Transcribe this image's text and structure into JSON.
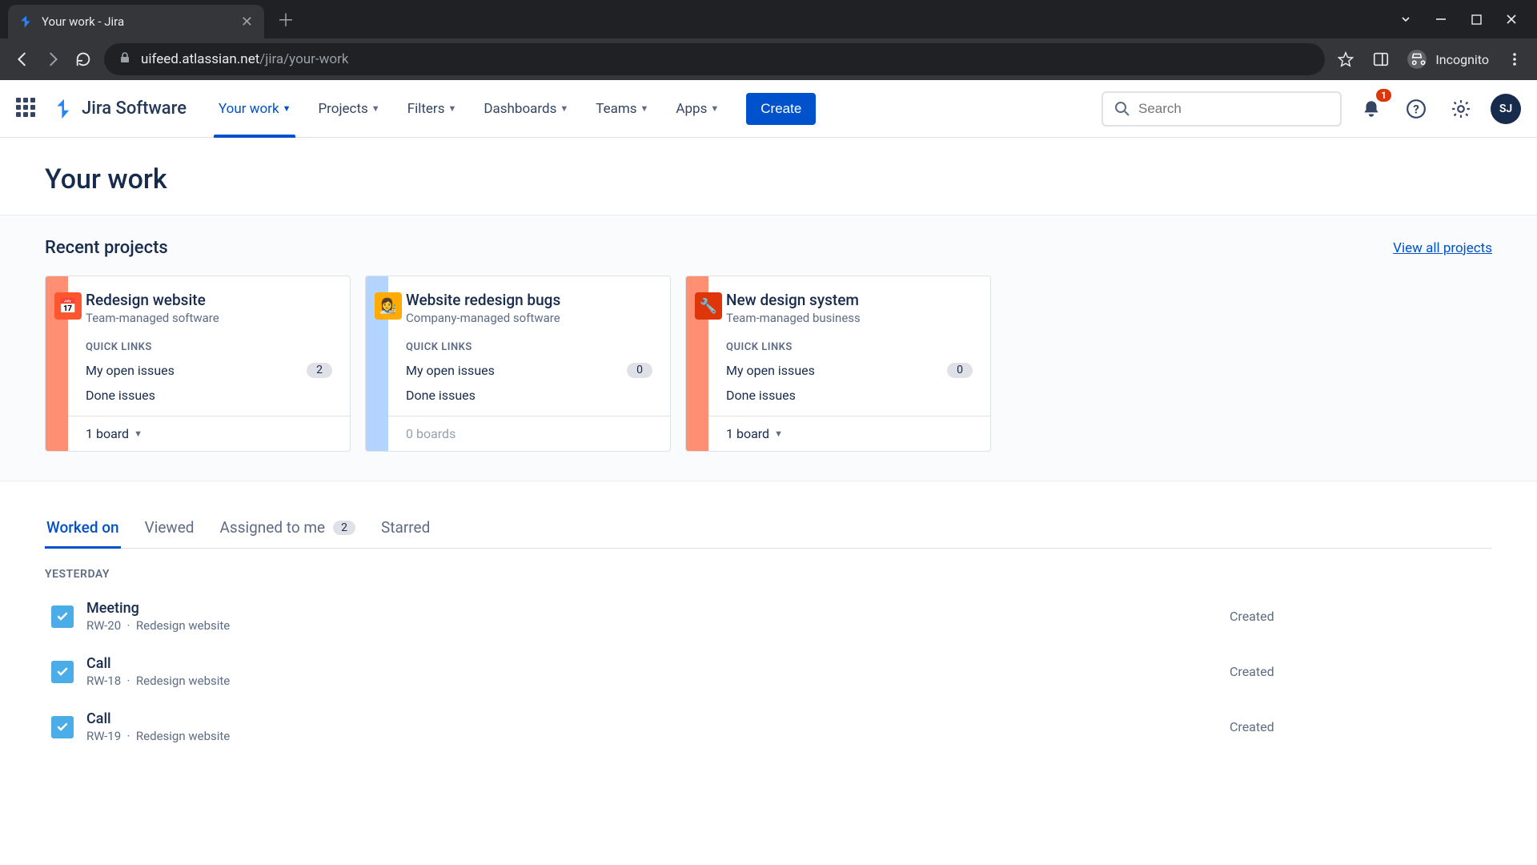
{
  "browser": {
    "tab_title": "Your work - Jira",
    "url_host": "uifeed.atlassian.net",
    "url_path": "/jira/your-work",
    "incognito_label": "Incognito"
  },
  "header": {
    "product_name": "Jira Software",
    "nav": {
      "your_work": "Your work",
      "projects": "Projects",
      "filters": "Filters",
      "dashboards": "Dashboards",
      "teams": "Teams",
      "apps": "Apps"
    },
    "create_label": "Create",
    "search_placeholder": "Search",
    "notification_count": "1",
    "avatar_initials": "SJ"
  },
  "page": {
    "title": "Your work",
    "recent_title": "Recent projects",
    "view_all_label": "View all projects"
  },
  "projects": [
    {
      "name": "Redesign website",
      "type": "Team-managed software",
      "stripe": "#ff8f73",
      "icon_bg": "#ff5630",
      "icon_glyph": "📅",
      "quick_label": "QUICK LINKS",
      "open_label": "My open issues",
      "open_count": "2",
      "done_label": "Done issues",
      "boards_label": "1 board",
      "has_boards": true
    },
    {
      "name": "Website redesign bugs",
      "type": "Company-managed software",
      "stripe": "#b3d4ff",
      "icon_bg": "#ffab00",
      "icon_glyph": "👩‍🎨",
      "quick_label": "QUICK LINKS",
      "open_label": "My open issues",
      "open_count": "0",
      "done_label": "Done issues",
      "boards_label": "0 boards",
      "has_boards": false
    },
    {
      "name": "New design system",
      "type": "Team-managed business",
      "stripe": "#ff8f73",
      "icon_bg": "#de350b",
      "icon_glyph": "🔧",
      "quick_label": "QUICK LINKS",
      "open_label": "My open issues",
      "open_count": "0",
      "done_label": "Done issues",
      "boards_label": "1 board",
      "has_boards": true
    }
  ],
  "work_tabs": {
    "worked_on": "Worked on",
    "viewed": "Viewed",
    "assigned": "Assigned to me",
    "assigned_count": "2",
    "starred": "Starred"
  },
  "group_label": "Yesterday",
  "issues": [
    {
      "title": "Meeting",
      "key": "RW-20",
      "project": "Redesign website",
      "status": "Created"
    },
    {
      "title": "Call",
      "key": "RW-18",
      "project": "Redesign website",
      "status": "Created"
    },
    {
      "title": "Call",
      "key": "RW-19",
      "project": "Redesign website",
      "status": "Created"
    }
  ]
}
